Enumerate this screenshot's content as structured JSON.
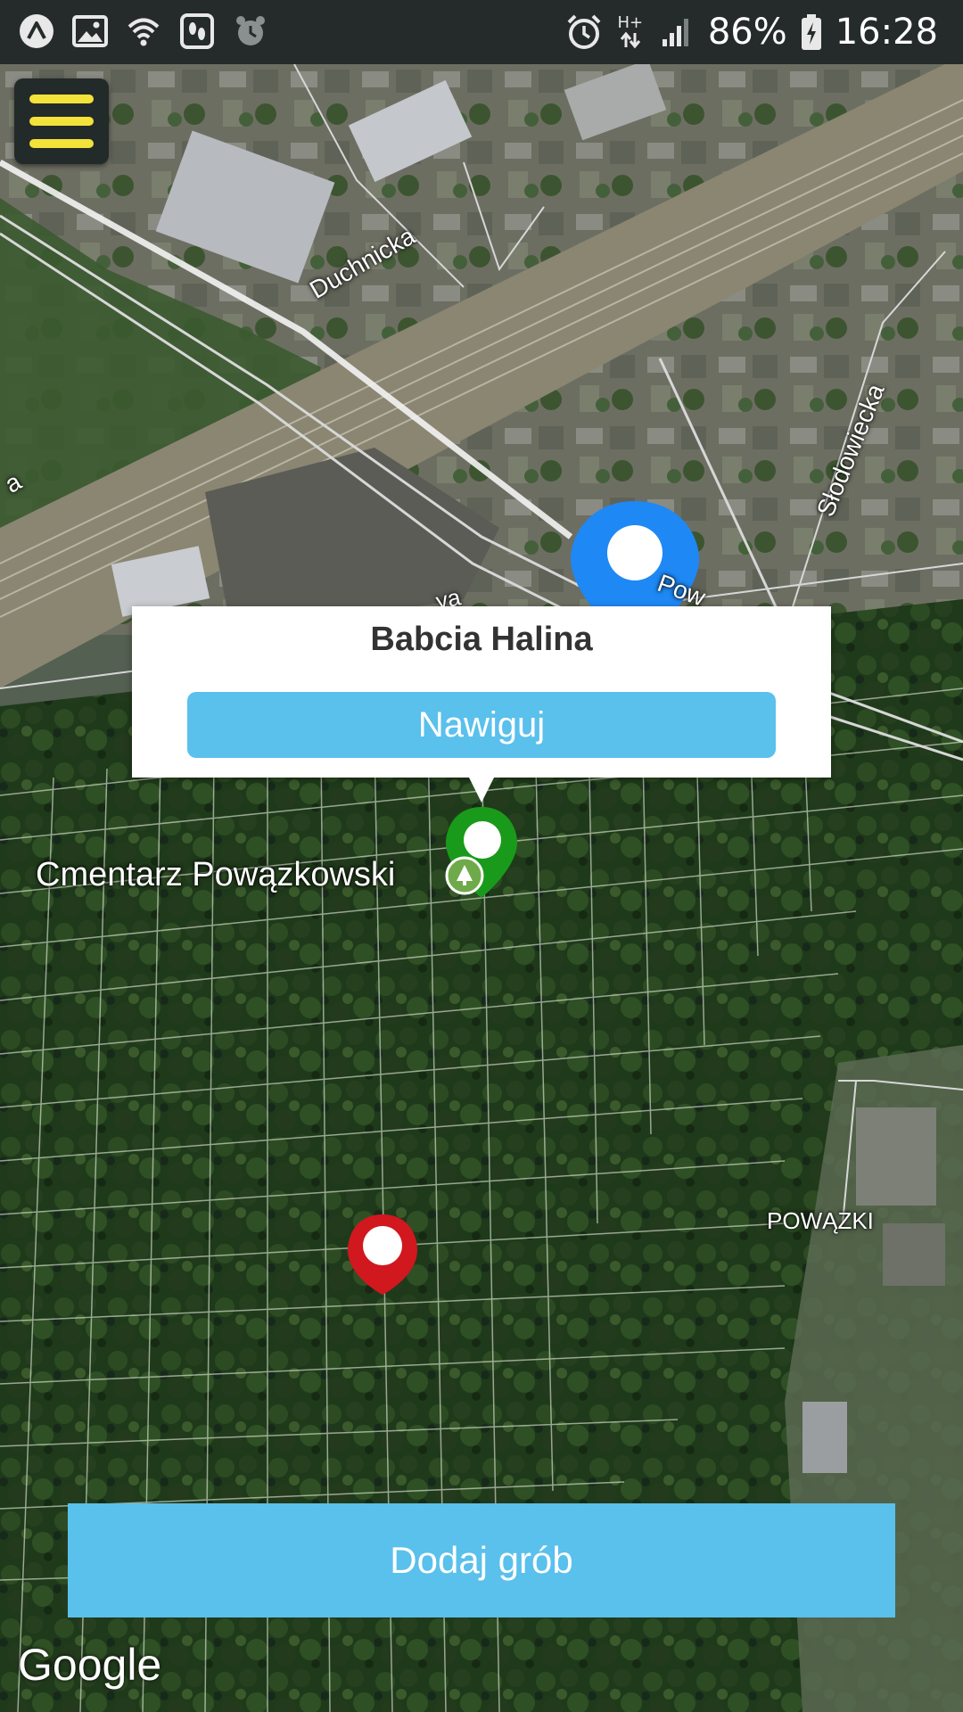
{
  "status_bar": {
    "battery_percent": "86%",
    "time": "16:28",
    "network_type": "H+",
    "left_icons": [
      "app-launcher-icon",
      "image-icon",
      "wifi-icon",
      "steps-icon",
      "alarm-app-icon"
    ],
    "right_icons": [
      "alarm-clock-icon",
      "data-transfer-icon",
      "signal-icon",
      "battery-charging-icon"
    ]
  },
  "map": {
    "streets": {
      "duchnicka": "Duchnicka",
      "slodowiecka": "Słodowiecka",
      "partial_left": "a",
      "partial_mid": "ya",
      "partial_pow": "Pow"
    },
    "places": {
      "cemetery": "Cmentarz Powązkowski",
      "district": "POWĄZKI"
    },
    "markers": [
      {
        "name": "current-location",
        "color": "#1e88f5",
        "icon": "map-pin-icon"
      },
      {
        "name": "selected-grave",
        "color": "#1a9a1a",
        "icon": "map-pin-icon"
      },
      {
        "name": "grave",
        "color": "#d0181e",
        "icon": "map-pin-icon"
      }
    ],
    "attribution": "Google"
  },
  "menu": {
    "icon": "hamburger-menu-icon",
    "accent_color": "#f2e23a"
  },
  "popup": {
    "title": "Babcia Halina",
    "navigate_label": "Nawiguj"
  },
  "actions": {
    "add_grave_label": "Dodaj grób",
    "button_color": "#5ac0ec"
  }
}
